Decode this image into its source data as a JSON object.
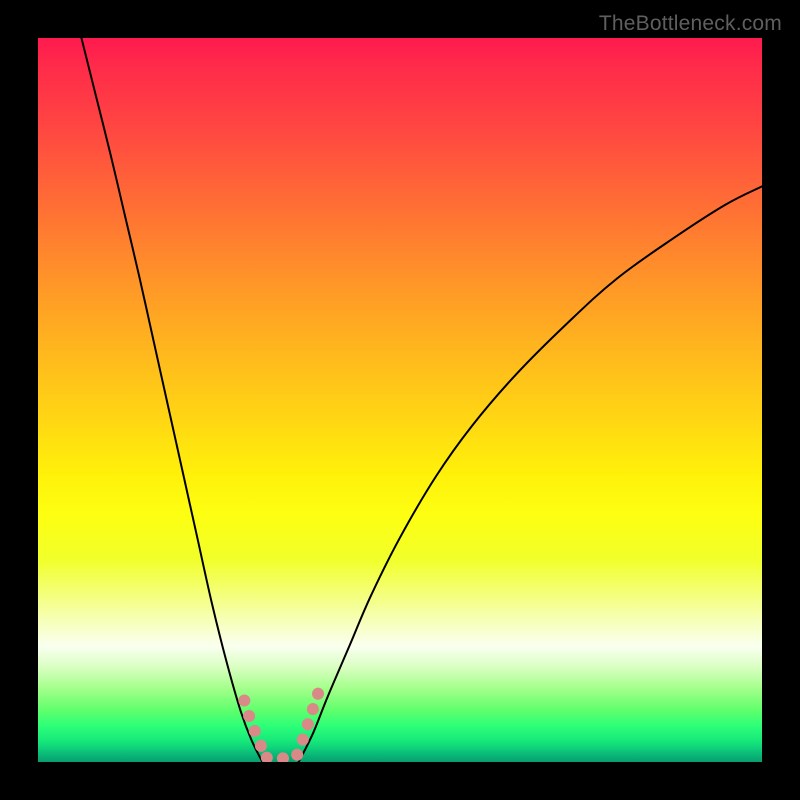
{
  "watermark": "TheBottleneck.com",
  "chart_data": {
    "type": "line",
    "title": "",
    "xlabel": "",
    "ylabel": "",
    "xlim": [
      0,
      100
    ],
    "ylim": [
      0,
      100
    ],
    "grid": false,
    "legend": false,
    "gradient_stops": [
      {
        "pct": 0,
        "color": "#ff1a4f"
      },
      {
        "pct": 12,
        "color": "#ff4542"
      },
      {
        "pct": 32,
        "color": "#ff8f2a"
      },
      {
        "pct": 52,
        "color": "#ffd414"
      },
      {
        "pct": 66,
        "color": "#fdff12"
      },
      {
        "pct": 84,
        "color": "#fafff0"
      },
      {
        "pct": 93,
        "color": "#5cff6c"
      },
      {
        "pct": 100,
        "color": "#089e6e"
      }
    ],
    "series": [
      {
        "name": "left-branch",
        "stroke": "#000000",
        "x": [
          6.0,
          8.0,
          10.0,
          12.0,
          14.0,
          16.0,
          18.0,
          20.0,
          22.0,
          24.0,
          26.0,
          28.0,
          29.5,
          31.0
        ],
        "y": [
          100.0,
          92.0,
          84.0,
          75.5,
          67.0,
          58.0,
          49.0,
          40.0,
          31.0,
          22.0,
          14.0,
          7.0,
          3.0,
          0.0
        ]
      },
      {
        "name": "right-branch",
        "stroke": "#000000",
        "x": [
          36.0,
          38.0,
          40.0,
          43.0,
          46.0,
          50.0,
          55.0,
          60.0,
          66.0,
          73.0,
          80.0,
          88.0,
          95.0,
          100.0
        ],
        "y": [
          0.0,
          4.0,
          9.0,
          16.0,
          23.0,
          31.0,
          39.5,
          46.5,
          53.5,
          60.5,
          66.8,
          72.5,
          77.0,
          79.5
        ]
      },
      {
        "name": "bottom-marker-left",
        "stroke": "#d98a88",
        "x": [
          28.5,
          29.0,
          29.6,
          30.2,
          30.8,
          31.4
        ],
        "y": [
          8.5,
          6.8,
          5.2,
          3.6,
          2.2,
          1.0
        ]
      },
      {
        "name": "bottom-marker-flat",
        "stroke": "#d98a88",
        "x": [
          31.6,
          32.6,
          33.6,
          34.6,
          35.6
        ],
        "y": [
          0.6,
          0.5,
          0.5,
          0.5,
          0.6
        ]
      },
      {
        "name": "bottom-marker-right",
        "stroke": "#d98a88",
        "x": [
          35.8,
          36.4,
          37.0,
          37.6,
          38.2,
          38.8
        ],
        "y": [
          1.0,
          2.6,
          4.4,
          6.2,
          8.0,
          9.8
        ]
      }
    ]
  }
}
